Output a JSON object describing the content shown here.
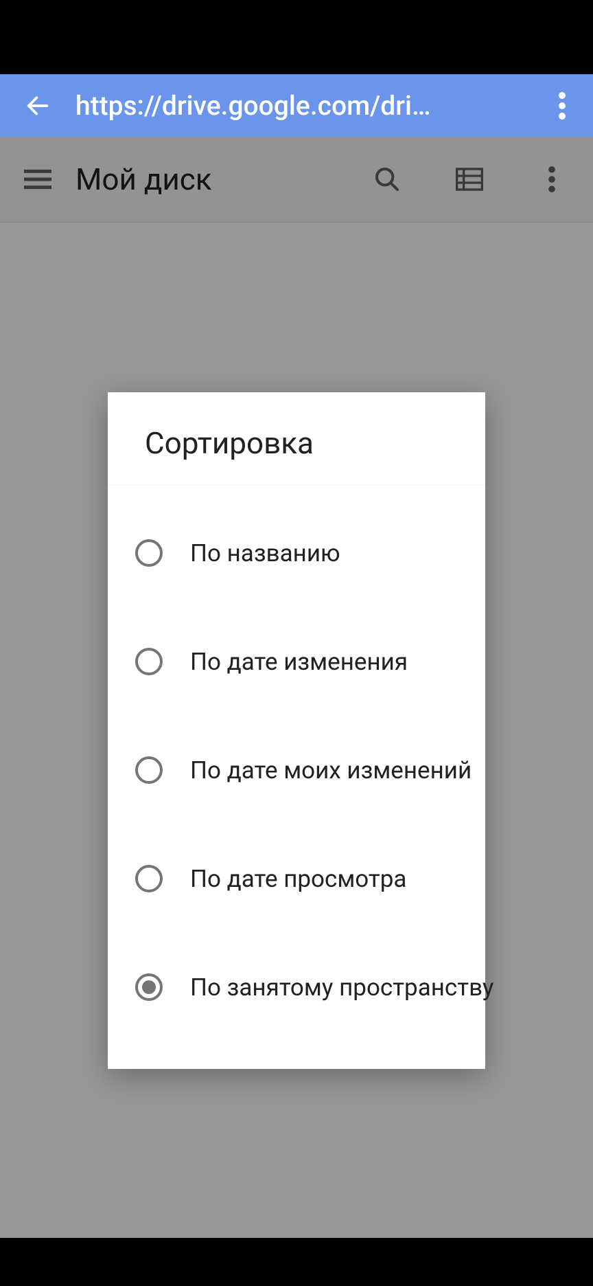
{
  "browser": {
    "url": "https://drive.google.com/dri…"
  },
  "drive": {
    "title": "Мой диск"
  },
  "dialog": {
    "title": "Сортировка",
    "options": [
      {
        "label": "По названию",
        "selected": false
      },
      {
        "label": "По дате изменения",
        "selected": false
      },
      {
        "label": "По дате моих изменений",
        "selected": false
      },
      {
        "label": "По дате просмотра",
        "selected": false
      },
      {
        "label": "По занятому пространству",
        "selected": true
      }
    ]
  }
}
